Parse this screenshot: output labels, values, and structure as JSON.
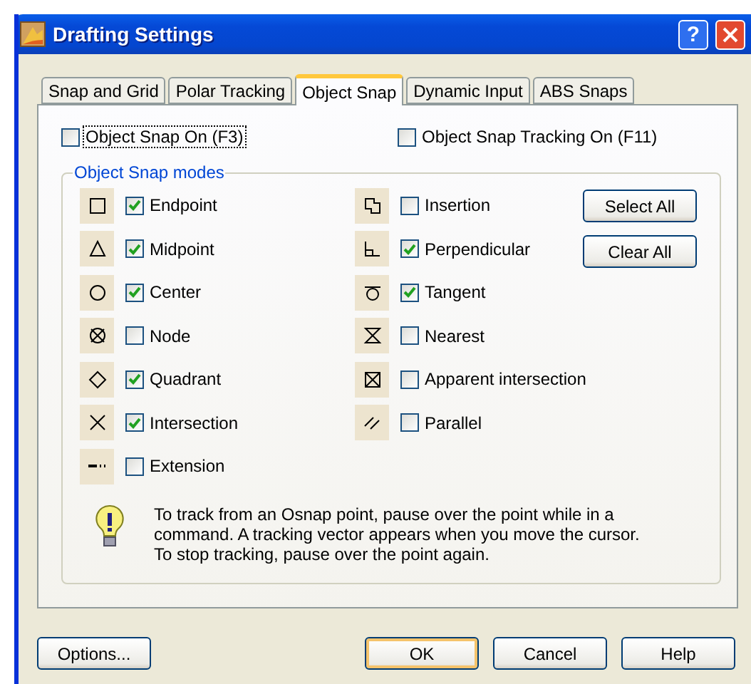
{
  "window": {
    "title": "Drafting Settings",
    "help_glyph": "?"
  },
  "tabs": [
    {
      "label": "Snap and Grid",
      "selected": false
    },
    {
      "label": "Polar Tracking",
      "selected": false
    },
    {
      "label": "Object Snap",
      "selected": true
    },
    {
      "label": "Dynamic Input",
      "selected": false
    },
    {
      "label": "ABS Snaps",
      "selected": false
    }
  ],
  "top_options": [
    {
      "label": "Object Snap On (F3)",
      "checked": false,
      "focused": true
    },
    {
      "label": "Object Snap Tracking On (F11)",
      "checked": false,
      "focused": false
    }
  ],
  "modes_group": {
    "title": "Object Snap modes",
    "left": [
      {
        "label": "Endpoint",
        "checked": true
      },
      {
        "label": "Midpoint",
        "checked": true
      },
      {
        "label": "Center",
        "checked": true
      },
      {
        "label": "Node",
        "checked": false
      },
      {
        "label": "Quadrant",
        "checked": true
      },
      {
        "label": "Intersection",
        "checked": true
      },
      {
        "label": "Extension",
        "checked": false
      }
    ],
    "right": [
      {
        "label": "Insertion",
        "checked": false
      },
      {
        "label": "Perpendicular",
        "checked": true
      },
      {
        "label": "Tangent",
        "checked": true
      },
      {
        "label": "Nearest",
        "checked": false
      },
      {
        "label": "Apparent intersection",
        "checked": false
      },
      {
        "label": "Parallel",
        "checked": false
      }
    ],
    "buttons": [
      "Select All",
      "Clear All"
    ],
    "tip": "To track from an Osnap point, pause over the point while in a command.  A tracking vector appears when you move the cursor. To stop tracking, pause over the point again."
  },
  "footer": [
    {
      "label": "Options...",
      "default": false
    },
    {
      "label": "OK",
      "default": true
    },
    {
      "label": "Cancel",
      "default": false
    },
    {
      "label": "Help",
      "default": false
    }
  ]
}
